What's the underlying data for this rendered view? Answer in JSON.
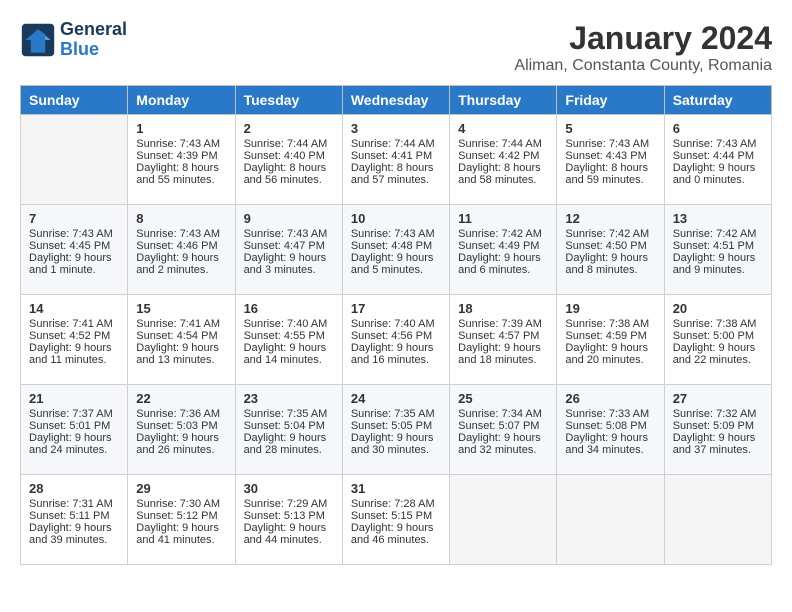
{
  "logo": {
    "line1": "General",
    "line2": "Blue"
  },
  "title": "January 2024",
  "location": "Aliman, Constanta County, Romania",
  "days_of_week": [
    "Sunday",
    "Monday",
    "Tuesday",
    "Wednesday",
    "Thursday",
    "Friday",
    "Saturday"
  ],
  "weeks": [
    [
      {
        "day": "",
        "empty": true
      },
      {
        "day": "1",
        "sunrise": "Sunrise: 7:43 AM",
        "sunset": "Sunset: 4:39 PM",
        "daylight": "Daylight: 8 hours and 55 minutes."
      },
      {
        "day": "2",
        "sunrise": "Sunrise: 7:44 AM",
        "sunset": "Sunset: 4:40 PM",
        "daylight": "Daylight: 8 hours and 56 minutes."
      },
      {
        "day": "3",
        "sunrise": "Sunrise: 7:44 AM",
        "sunset": "Sunset: 4:41 PM",
        "daylight": "Daylight: 8 hours and 57 minutes."
      },
      {
        "day": "4",
        "sunrise": "Sunrise: 7:44 AM",
        "sunset": "Sunset: 4:42 PM",
        "daylight": "Daylight: 8 hours and 58 minutes."
      },
      {
        "day": "5",
        "sunrise": "Sunrise: 7:43 AM",
        "sunset": "Sunset: 4:43 PM",
        "daylight": "Daylight: 8 hours and 59 minutes."
      },
      {
        "day": "6",
        "sunrise": "Sunrise: 7:43 AM",
        "sunset": "Sunset: 4:44 PM",
        "daylight": "Daylight: 9 hours and 0 minutes."
      }
    ],
    [
      {
        "day": "7",
        "sunrise": "Sunrise: 7:43 AM",
        "sunset": "Sunset: 4:45 PM",
        "daylight": "Daylight: 9 hours and 1 minute."
      },
      {
        "day": "8",
        "sunrise": "Sunrise: 7:43 AM",
        "sunset": "Sunset: 4:46 PM",
        "daylight": "Daylight: 9 hours and 2 minutes."
      },
      {
        "day": "9",
        "sunrise": "Sunrise: 7:43 AM",
        "sunset": "Sunset: 4:47 PM",
        "daylight": "Daylight: 9 hours and 3 minutes."
      },
      {
        "day": "10",
        "sunrise": "Sunrise: 7:43 AM",
        "sunset": "Sunset: 4:48 PM",
        "daylight": "Daylight: 9 hours and 5 minutes."
      },
      {
        "day": "11",
        "sunrise": "Sunrise: 7:42 AM",
        "sunset": "Sunset: 4:49 PM",
        "daylight": "Daylight: 9 hours and 6 minutes."
      },
      {
        "day": "12",
        "sunrise": "Sunrise: 7:42 AM",
        "sunset": "Sunset: 4:50 PM",
        "daylight": "Daylight: 9 hours and 8 minutes."
      },
      {
        "day": "13",
        "sunrise": "Sunrise: 7:42 AM",
        "sunset": "Sunset: 4:51 PM",
        "daylight": "Daylight: 9 hours and 9 minutes."
      }
    ],
    [
      {
        "day": "14",
        "sunrise": "Sunrise: 7:41 AM",
        "sunset": "Sunset: 4:52 PM",
        "daylight": "Daylight: 9 hours and 11 minutes."
      },
      {
        "day": "15",
        "sunrise": "Sunrise: 7:41 AM",
        "sunset": "Sunset: 4:54 PM",
        "daylight": "Daylight: 9 hours and 13 minutes."
      },
      {
        "day": "16",
        "sunrise": "Sunrise: 7:40 AM",
        "sunset": "Sunset: 4:55 PM",
        "daylight": "Daylight: 9 hours and 14 minutes."
      },
      {
        "day": "17",
        "sunrise": "Sunrise: 7:40 AM",
        "sunset": "Sunset: 4:56 PM",
        "daylight": "Daylight: 9 hours and 16 minutes."
      },
      {
        "day": "18",
        "sunrise": "Sunrise: 7:39 AM",
        "sunset": "Sunset: 4:57 PM",
        "daylight": "Daylight: 9 hours and 18 minutes."
      },
      {
        "day": "19",
        "sunrise": "Sunrise: 7:38 AM",
        "sunset": "Sunset: 4:59 PM",
        "daylight": "Daylight: 9 hours and 20 minutes."
      },
      {
        "day": "20",
        "sunrise": "Sunrise: 7:38 AM",
        "sunset": "Sunset: 5:00 PM",
        "daylight": "Daylight: 9 hours and 22 minutes."
      }
    ],
    [
      {
        "day": "21",
        "sunrise": "Sunrise: 7:37 AM",
        "sunset": "Sunset: 5:01 PM",
        "daylight": "Daylight: 9 hours and 24 minutes."
      },
      {
        "day": "22",
        "sunrise": "Sunrise: 7:36 AM",
        "sunset": "Sunset: 5:03 PM",
        "daylight": "Daylight: 9 hours and 26 minutes."
      },
      {
        "day": "23",
        "sunrise": "Sunrise: 7:35 AM",
        "sunset": "Sunset: 5:04 PM",
        "daylight": "Daylight: 9 hours and 28 minutes."
      },
      {
        "day": "24",
        "sunrise": "Sunrise: 7:35 AM",
        "sunset": "Sunset: 5:05 PM",
        "daylight": "Daylight: 9 hours and 30 minutes."
      },
      {
        "day": "25",
        "sunrise": "Sunrise: 7:34 AM",
        "sunset": "Sunset: 5:07 PM",
        "daylight": "Daylight: 9 hours and 32 minutes."
      },
      {
        "day": "26",
        "sunrise": "Sunrise: 7:33 AM",
        "sunset": "Sunset: 5:08 PM",
        "daylight": "Daylight: 9 hours and 34 minutes."
      },
      {
        "day": "27",
        "sunrise": "Sunrise: 7:32 AM",
        "sunset": "Sunset: 5:09 PM",
        "daylight": "Daylight: 9 hours and 37 minutes."
      }
    ],
    [
      {
        "day": "28",
        "sunrise": "Sunrise: 7:31 AM",
        "sunset": "Sunset: 5:11 PM",
        "daylight": "Daylight: 9 hours and 39 minutes."
      },
      {
        "day": "29",
        "sunrise": "Sunrise: 7:30 AM",
        "sunset": "Sunset: 5:12 PM",
        "daylight": "Daylight: 9 hours and 41 minutes."
      },
      {
        "day": "30",
        "sunrise": "Sunrise: 7:29 AM",
        "sunset": "Sunset: 5:13 PM",
        "daylight": "Daylight: 9 hours and 44 minutes."
      },
      {
        "day": "31",
        "sunrise": "Sunrise: 7:28 AM",
        "sunset": "Sunset: 5:15 PM",
        "daylight": "Daylight: 9 hours and 46 minutes."
      },
      {
        "day": "",
        "empty": true
      },
      {
        "day": "",
        "empty": true
      },
      {
        "day": "",
        "empty": true
      }
    ]
  ]
}
